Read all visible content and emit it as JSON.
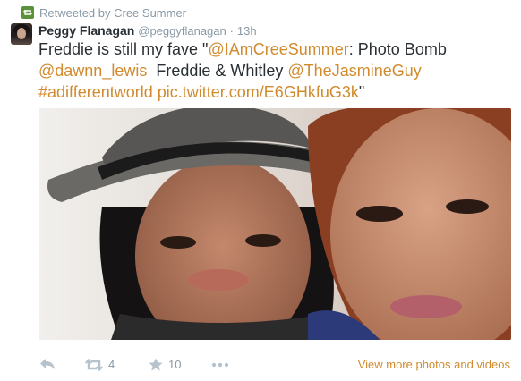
{
  "retweet_context": {
    "text": "Retweeted by Cree Summer"
  },
  "tweet": {
    "author_name": "Peggy Flanagan",
    "author_handle": "@peggyflanagan",
    "separator": "·",
    "time": "13h",
    "text": {
      "t1": "Freddie is still my fave \"",
      "mention1": "@IAmCreeSummer",
      "t2": ": Photo Bomb ",
      "mention2": "@dawnn_lewis",
      "t3": "  Freddie & Whitley ",
      "mention3": "@TheJasmineGuy",
      "t4": " ",
      "hashtag": "#adifferentworld",
      "link": "pic.twitter.com/E6GHkfuG3k",
      "t5": "\""
    }
  },
  "actions": {
    "reply_icon": "reply-icon",
    "retweet_icon": "retweet-icon",
    "retweet_count": "4",
    "favorite_icon": "star-icon",
    "favorite_count": "10",
    "more_icon": "more-icon",
    "view_more": "View more photos and videos"
  },
  "colors": {
    "link": "#d18b2e",
    "muted": "#8899a6",
    "retweet_green": "#5c913b"
  }
}
